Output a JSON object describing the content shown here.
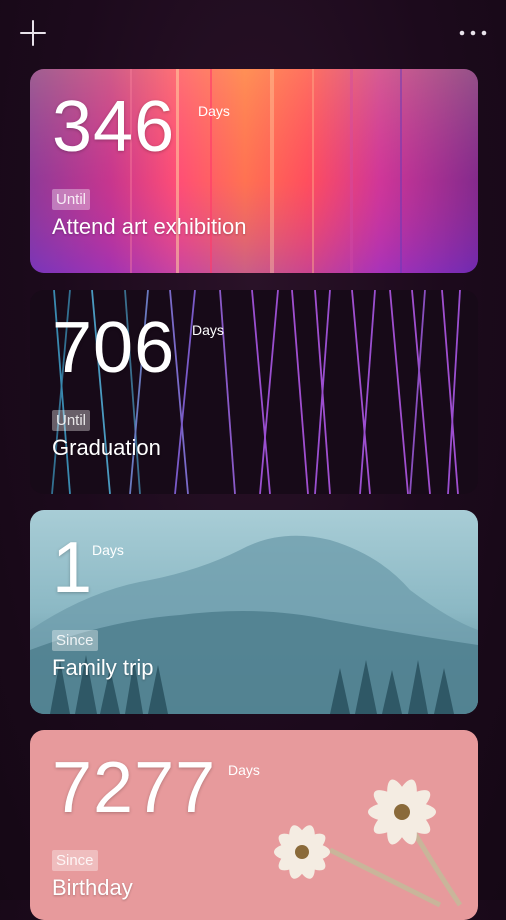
{
  "toolbar": {
    "add_icon": "plus-icon",
    "more_icon": "more-horizontal-icon"
  },
  "events": [
    {
      "count": "346",
      "unit": "Days",
      "relation": "Until",
      "title": "Attend art exhibition",
      "theme": "abstract-gradient",
      "accent": "#ff3a7a"
    },
    {
      "count": "706",
      "unit": "Days",
      "relation": "Until",
      "title": "Graduation",
      "theme": "purple-lines",
      "accent": "#9a4fd0"
    },
    {
      "count": "1",
      "unit": "Days",
      "relation": "Since",
      "title": "Family trip",
      "theme": "snowy-forest",
      "accent": "#7fb1c0"
    },
    {
      "count": "7277",
      "unit": "Days",
      "relation": "Since",
      "title": "Birthday",
      "theme": "pink-flowers",
      "accent": "#e79a9c"
    }
  ]
}
